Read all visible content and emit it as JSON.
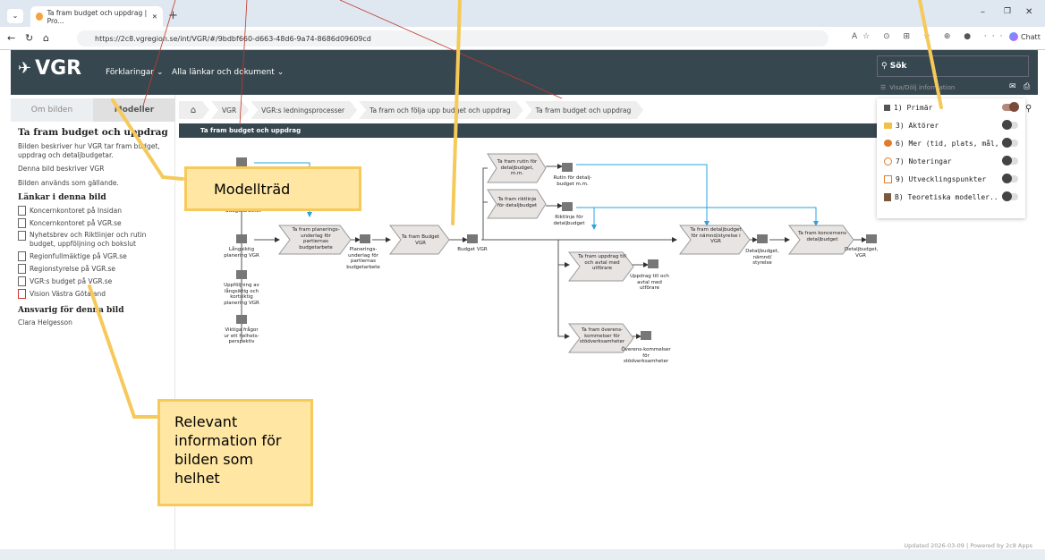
{
  "browser": {
    "tab_title": "Ta fram budget och uppdrag | Pro...",
    "url": "https://2c8.vgregion.se/int/VGR/#/9bdbf660-d663-48d6-9a74-8686d09609cd",
    "copilot": "Chatt"
  },
  "header": {
    "logo": "VGR",
    "nav1": "Förklaringar",
    "nav2": "Alla länkar och dokument",
    "search": "Sök",
    "visadolj": "Visa/Dölj information"
  },
  "left_tabs": {
    "tab1": "Om bilden",
    "tab2": "Modeller"
  },
  "left": {
    "title": "Ta fram budget och uppdrag",
    "desc": "Bilden beskriver hur VGR tar fram budget, uppdrag och detaljbudgetar.",
    "describes": "Denna bild beskriver VGR",
    "used": "Bilden används som gällande.",
    "links_heading": "Länkar i denna bild",
    "links": [
      "Koncernkontoret på Insidan",
      "Koncernkontoret på VGR.se",
      "Nyhetsbrev och Riktlinjer och rutin budget, uppföljning och bokslut",
      "Regionfullmäktige på VGR.se",
      "Regionstyrelse på VGR.se",
      "VGR:s budget på VGR.se",
      "Vision Västra Götaland"
    ],
    "resp_heading": "Ansvarig för denna bild",
    "resp_name": "Clara Helgesson"
  },
  "breadcrumbs": [
    "VGR",
    "VGR:s ledningsprocesser",
    "Ta fram och följa upp budget och uppdrag",
    "Ta fram budget och uppdrag"
  ],
  "diagram_title": "Ta fram budget och uppdrag",
  "diagram": {
    "lbl_underlag": "underlag för budgetarbetet",
    "lbl_langsiktig": "Långsiktig planering VGR",
    "lbl_uppfoljning": "Uppföljning av långsiktig och kortsiktig planering VGR",
    "lbl_viktiga": "Viktiga frågor ur ett helhets-perspektiv",
    "p_planering": "Ta fram planerings-underlag för partiernas budgetarbete",
    "lbl_planering": "Planerings-underlag för partiernas budgetarbete",
    "p_budget": "Ta fram Budget VGR",
    "lbl_budget": "Budget VGR",
    "p_rutin": "Ta fram rutin för detaljbudget, m.m.",
    "lbl_rutin": "Rutin för detalj-budget m.m.",
    "p_riktlinje": "Ta fram riktlinje för detaljbudget",
    "lbl_riktlinje": "Riktlinje för detaljbudget",
    "p_uppdrag": "Ta fram uppdrag till och avtal med utförare",
    "lbl_uppdrag": "Uppdrag till och avtal med utförare",
    "p_overens": "Ta fram överens-kommelser för stödverksamheter",
    "lbl_overens": "Överens-kommelser för stödverksamheter",
    "p_detaljnamnd": "Ta fram detaljbudget för nämnd/styrelse i VGR",
    "lbl_detaljnamnd": "Detaljbudget, nämnd/ styrelse",
    "p_koncern": "Ta fram koncernens detaljbudget",
    "lbl_koncern": "Detaljbudget, VGR"
  },
  "dropdown": [
    {
      "label": "1) Primär",
      "on": true
    },
    {
      "label": "3) Aktörer",
      "on": false
    },
    {
      "label": "6) Mer (tid, plats, mål,...",
      "on": false
    },
    {
      "label": "7) Noteringar",
      "on": false
    },
    {
      "label": "9) Utvecklingspunkter",
      "on": false
    },
    {
      "label": "B) Teoretiska modeller...",
      "on": false
    }
  ],
  "callouts": {
    "modelltrad": "Modellträd",
    "relevant": "Relevant information för bilden som helhet"
  },
  "footer": "Updated 2026-03-09 | Powered by 2c8 Apps",
  "colors": {
    "header": "#37474f",
    "accent": "#29a3d8",
    "callout": "#ffe7a3",
    "callout_border": "#f5c95a"
  }
}
